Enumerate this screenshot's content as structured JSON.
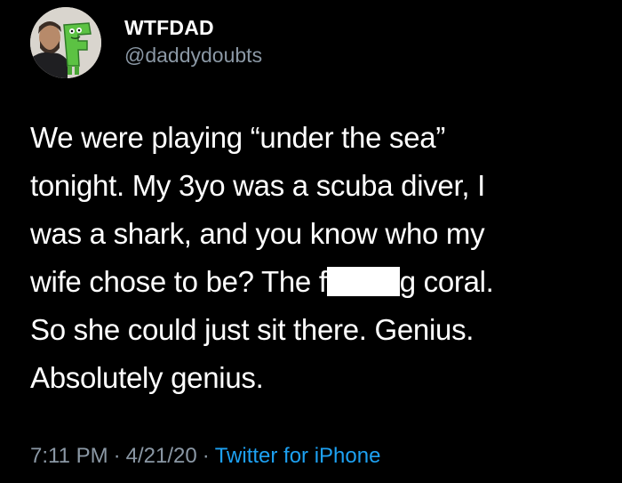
{
  "colors": {
    "background": "#000000",
    "text": "#ffffff",
    "secondary": "#8b98a5",
    "link": "#1da1f2",
    "redaction": "#ffffff"
  },
  "tweet": {
    "display_name": "WTFDAD",
    "handle": "@daddydoubts",
    "body_before_redaction": "We were playing “under the sea”\ntonight. My 3yo was a scuba diver, I\nwas a shark, and you know who my\nwife chose to be? The f",
    "body_after_redaction": "g coral.\nSo she could just sit there. Genius.\nAbsolutely genius.",
    "time": "7:11 PM",
    "date": "4/21/20",
    "separator": "·",
    "source": "Twitter for iPhone"
  }
}
